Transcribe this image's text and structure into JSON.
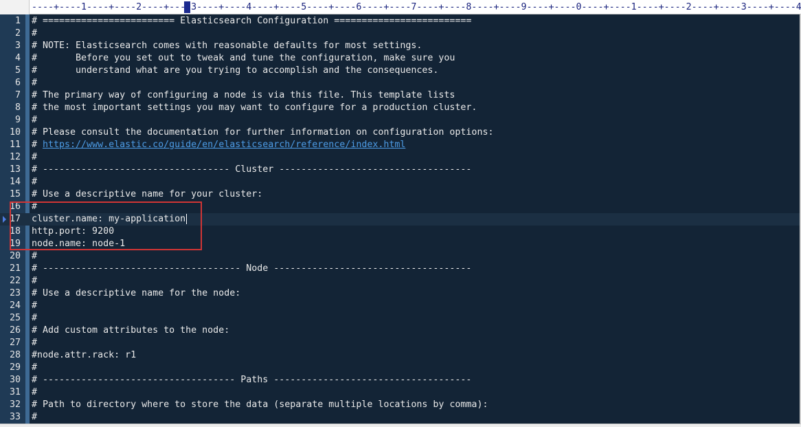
{
  "ruler": {
    "text": "----+----1----+----2----+----3----+----4----+----5----+----6----+----7----+----8----+----9----+----0----+----1----+----2----+----3----+----4"
  },
  "editor": {
    "current_line": 17,
    "highlighted_lines": [
      16,
      17,
      18,
      19
    ],
    "lines": [
      {
        "num": "1",
        "text": "# ======================== Elasticsearch Configuration ========================="
      },
      {
        "num": "2",
        "text": "#"
      },
      {
        "num": "3",
        "text": "# NOTE: Elasticsearch comes with reasonable defaults for most settings."
      },
      {
        "num": "4",
        "text": "#       Before you set out to tweak and tune the configuration, make sure you"
      },
      {
        "num": "5",
        "text": "#       understand what are you trying to accomplish and the consequences."
      },
      {
        "num": "6",
        "text": "#"
      },
      {
        "num": "7",
        "text": "# The primary way of configuring a node is via this file. This template lists"
      },
      {
        "num": "8",
        "text": "# the most important settings you may want to configure for a production cluster."
      },
      {
        "num": "9",
        "text": "#"
      },
      {
        "num": "10",
        "text": "# Please consult the documentation for further information on configuration options:"
      },
      {
        "num": "11",
        "text": "# ",
        "link": "https://www.elastic.co/guide/en/elasticsearch/reference/index.html"
      },
      {
        "num": "12",
        "text": "#"
      },
      {
        "num": "13",
        "text": "# ---------------------------------- Cluster -----------------------------------"
      },
      {
        "num": "14",
        "text": "#"
      },
      {
        "num": "15",
        "text": "# Use a descriptive name for your cluster:"
      },
      {
        "num": "16",
        "text": "#"
      },
      {
        "num": "17",
        "text": "cluster.name: my-application"
      },
      {
        "num": "18",
        "text": "http.port: 9200"
      },
      {
        "num": "19",
        "text": "node.name: node-1"
      },
      {
        "num": "20",
        "text": "#"
      },
      {
        "num": "21",
        "text": "# ------------------------------------ Node ------------------------------------"
      },
      {
        "num": "22",
        "text": "#"
      },
      {
        "num": "23",
        "text": "# Use a descriptive name for the node:"
      },
      {
        "num": "24",
        "text": "#"
      },
      {
        "num": "25",
        "text": "#"
      },
      {
        "num": "26",
        "text": "# Add custom attributes to the node:"
      },
      {
        "num": "27",
        "text": "#"
      },
      {
        "num": "28",
        "text": "#node.attr.rack: r1"
      },
      {
        "num": "29",
        "text": "#"
      },
      {
        "num": "30",
        "text": "# ----------------------------------- Paths ------------------------------------"
      },
      {
        "num": "31",
        "text": "#"
      },
      {
        "num": "32",
        "text": "# Path to directory where to store the data (separate multiple locations by comma):"
      },
      {
        "num": "33",
        "text": "#"
      }
    ]
  },
  "colors": {
    "editor_bg": "#132436",
    "text": "#eaeaea",
    "link": "#4d9ce6",
    "highlight_border": "#d23535"
  }
}
